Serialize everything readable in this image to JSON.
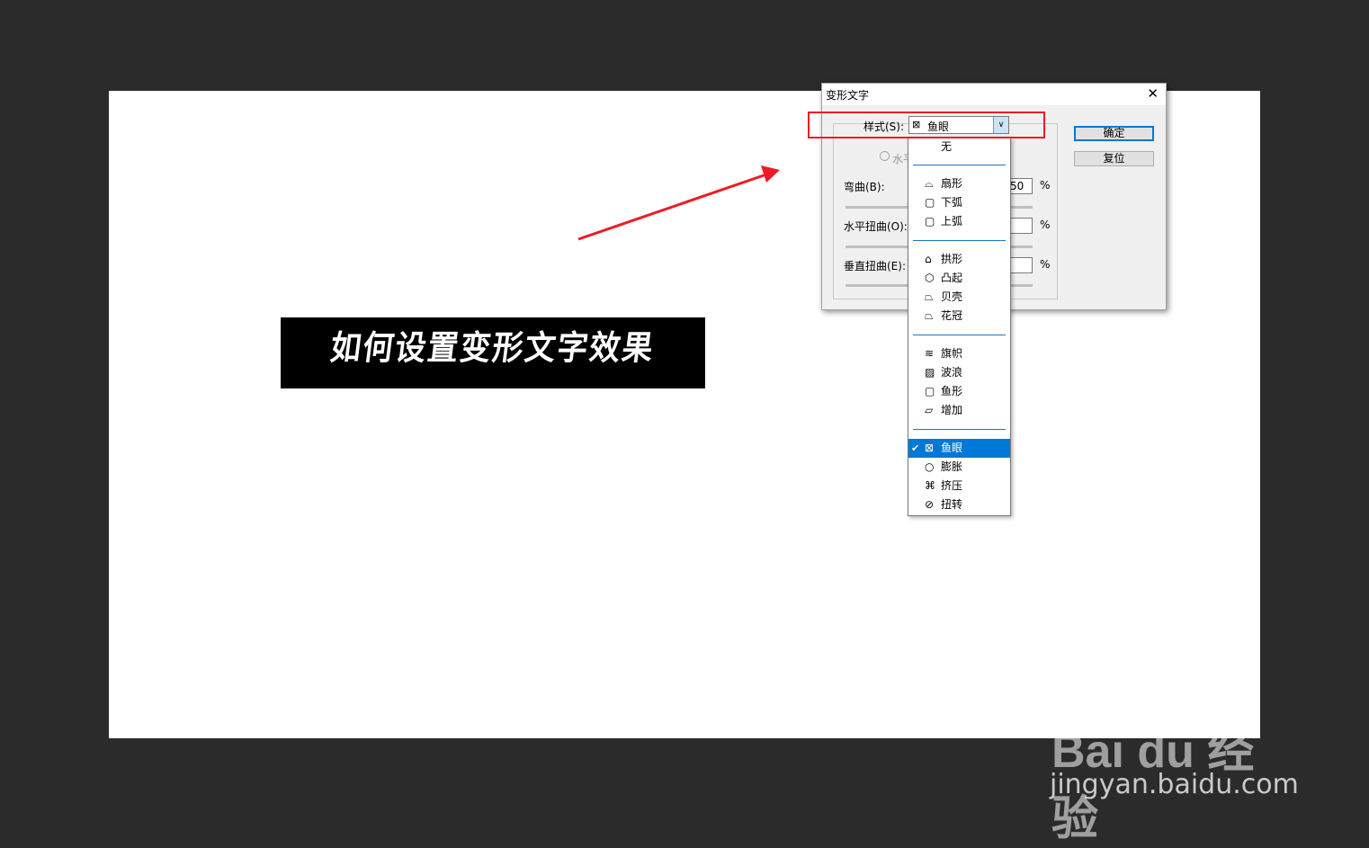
{
  "canvas": {
    "warped_text": "如何设置变形文字效果"
  },
  "dialog": {
    "title": "变形文字",
    "close_glyph": "✕",
    "style_label": "样式(S):",
    "style_value": "鱼眼",
    "style_icon": "fisheye-icon",
    "radio_text": "水平",
    "bend_label": "弯曲(B):",
    "bend_value": "50",
    "hdist_label": "水平扭曲(O):",
    "hdist_value": "",
    "vdist_label": "垂直扭曲(E):",
    "vdist_value": "",
    "percent": "%",
    "ok_label": "确定",
    "reset_label": "复位"
  },
  "dropdown": {
    "none_label": "无",
    "items": [
      {
        "label": "扇形",
        "icon": "arc-icon"
      },
      {
        "label": "下弧",
        "icon": "arc-lower-icon"
      },
      {
        "label": "上弧",
        "icon": "arc-upper-icon"
      },
      {
        "label": "拱形",
        "icon": "arch-icon"
      },
      {
        "label": "凸起",
        "icon": "bulge-icon"
      },
      {
        "label": "贝壳",
        "icon": "shell-lower-icon"
      },
      {
        "label": "花冠",
        "icon": "shell-upper-icon"
      },
      {
        "label": "旗帜",
        "icon": "flag-icon"
      },
      {
        "label": "波浪",
        "icon": "wave-icon"
      },
      {
        "label": "鱼形",
        "icon": "fish-icon"
      },
      {
        "label": "增加",
        "icon": "rise-icon"
      },
      {
        "label": "鱼眼",
        "icon": "fisheye-icon"
      },
      {
        "label": "膨胀",
        "icon": "inflate-icon"
      },
      {
        "label": "挤压",
        "icon": "squeeze-icon"
      },
      {
        "label": "扭转",
        "icon": "twist-icon"
      }
    ],
    "selected": "鱼眼"
  },
  "colors": {
    "highlight": "#ee1b24",
    "selection": "#0078d7",
    "background": "#2b2b2b"
  },
  "watermark": {
    "logo": "Bai du 经验",
    "url": "jingyan.baidu.com"
  }
}
